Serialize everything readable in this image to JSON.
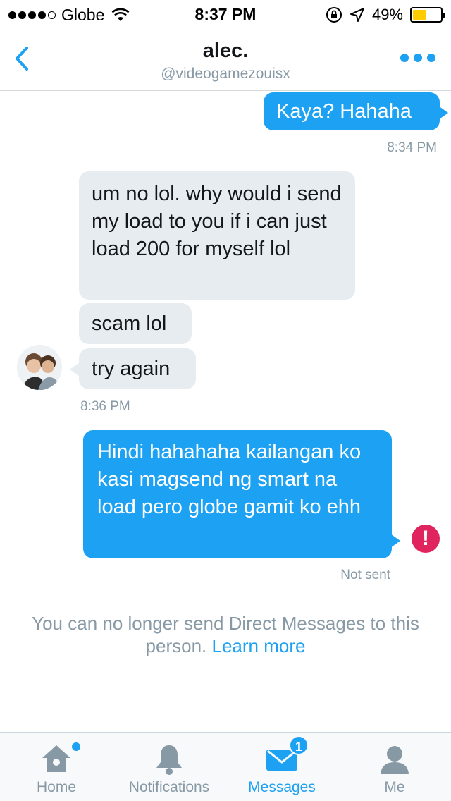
{
  "status_bar": {
    "carrier": "Globe",
    "time": "8:37 PM",
    "battery_percent": "49%",
    "battery_level": 0.49,
    "signal_bars": 4
  },
  "header": {
    "title": "alec.",
    "handle": "@videogamezouisx",
    "back_icon": "chevron-left-icon",
    "more_icon": "more-dots-icon"
  },
  "conversation": {
    "msg1": {
      "text": "Kaya? Hahaha",
      "time": "8:34 PM"
    },
    "msg2": {
      "text": "um no lol. why would i send my load to you if i can just load 200 for myself lol"
    },
    "msg3": {
      "text": "scam lol"
    },
    "msg4": {
      "text": "try again",
      "time": "8:36 PM"
    },
    "msg5": {
      "text": "Hindi hahahaha kailangan ko kasi magsend ng smart na load pero globe gamit ko ehh",
      "status": "Not sent",
      "error_symbol": "!"
    }
  },
  "notice": {
    "text": "You can no longer send Direct Messages to this person.",
    "link": "Learn more"
  },
  "tabs": {
    "home": {
      "label": "Home",
      "icon": "home-icon"
    },
    "notifications": {
      "label": "Notifications",
      "icon": "bell-icon"
    },
    "messages": {
      "label": "Messages",
      "icon": "envelope-icon",
      "badge": "1"
    },
    "me": {
      "label": "Me",
      "icon": "person-icon"
    }
  },
  "colors": {
    "accent": "#1da1f2",
    "incoming_bubble": "#e6ecf0",
    "error": "#e0245e",
    "muted_text": "#8899a6"
  }
}
